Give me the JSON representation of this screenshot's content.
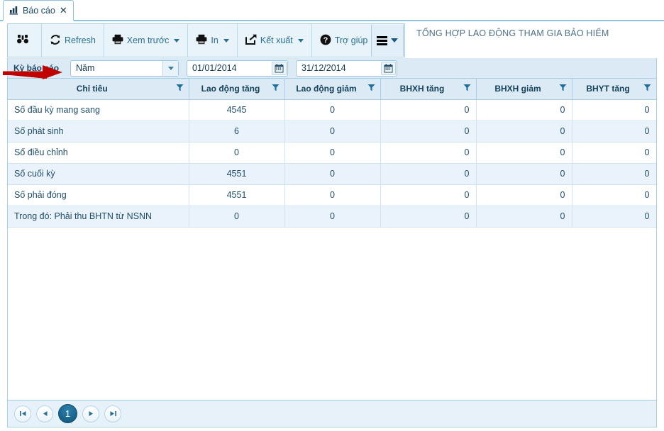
{
  "tab": {
    "label": "Báo cáo",
    "icon": "bar-chart-icon",
    "close": "✕"
  },
  "toolbar": {
    "buttons": [
      {
        "label": "",
        "icon": "binoculars-icon",
        "caret": false
      },
      {
        "label": "Refresh",
        "icon": "refresh-icon",
        "caret": false
      },
      {
        "label": "Xem trước",
        "icon": "print-preview-icon",
        "caret": true
      },
      {
        "label": "In",
        "icon": "printer-icon",
        "caret": true
      },
      {
        "label": "Kết xuất",
        "icon": "export-icon",
        "caret": true
      },
      {
        "label": "Trợ giúp",
        "icon": "help-icon",
        "caret": false
      }
    ],
    "menu_icon": "hamburger-icon"
  },
  "report": {
    "title": "TỔNG HỢP LAO ĐỘNG THAM GIA BẢO HIỂM"
  },
  "filter": {
    "period_label": "Kỳ báo cáo",
    "period_value": "Năm",
    "from_date": "01/01/2014",
    "to_date": "31/12/2014",
    "calendar_icon": "calendar-icon"
  },
  "grid": {
    "columns": [
      {
        "label": "Chỉ tiêu",
        "align": "c-label"
      },
      {
        "label": "Lao động tăng",
        "align": "c-center"
      },
      {
        "label": "Lao động giảm",
        "align": "c-center"
      },
      {
        "label": "BHXH tăng",
        "align": "c-right"
      },
      {
        "label": "BHXH giảm",
        "align": "c-right"
      },
      {
        "label": "BHYT tăng",
        "align": "c-right"
      }
    ],
    "rows": [
      {
        "cells": [
          "Số đầu kỳ mang sang",
          "4545",
          "0",
          "0",
          "0",
          "0"
        ]
      },
      {
        "cells": [
          "Số phát sinh",
          "6",
          "0",
          "0",
          "0",
          "0"
        ]
      },
      {
        "cells": [
          "Số điều chỉnh",
          "0",
          "0",
          "0",
          "0",
          "0"
        ]
      },
      {
        "cells": [
          "Số cuối kỳ",
          "4551",
          "0",
          "0",
          "0",
          "0"
        ]
      },
      {
        "cells": [
          "Số phải đóng",
          "4551",
          "0",
          "0",
          "0",
          "0"
        ]
      },
      {
        "cells": [
          "Trong đó: Phải thu BHTN từ NSNN",
          "0",
          "0",
          "0",
          "0",
          "0"
        ]
      }
    ]
  },
  "pager": {
    "first": "first-page-icon",
    "prev": "previous-page-icon",
    "current": "1",
    "next": "next-page-icon",
    "last": "last-page-icon"
  },
  "annotation": {
    "arrow_color": "#c00000"
  }
}
